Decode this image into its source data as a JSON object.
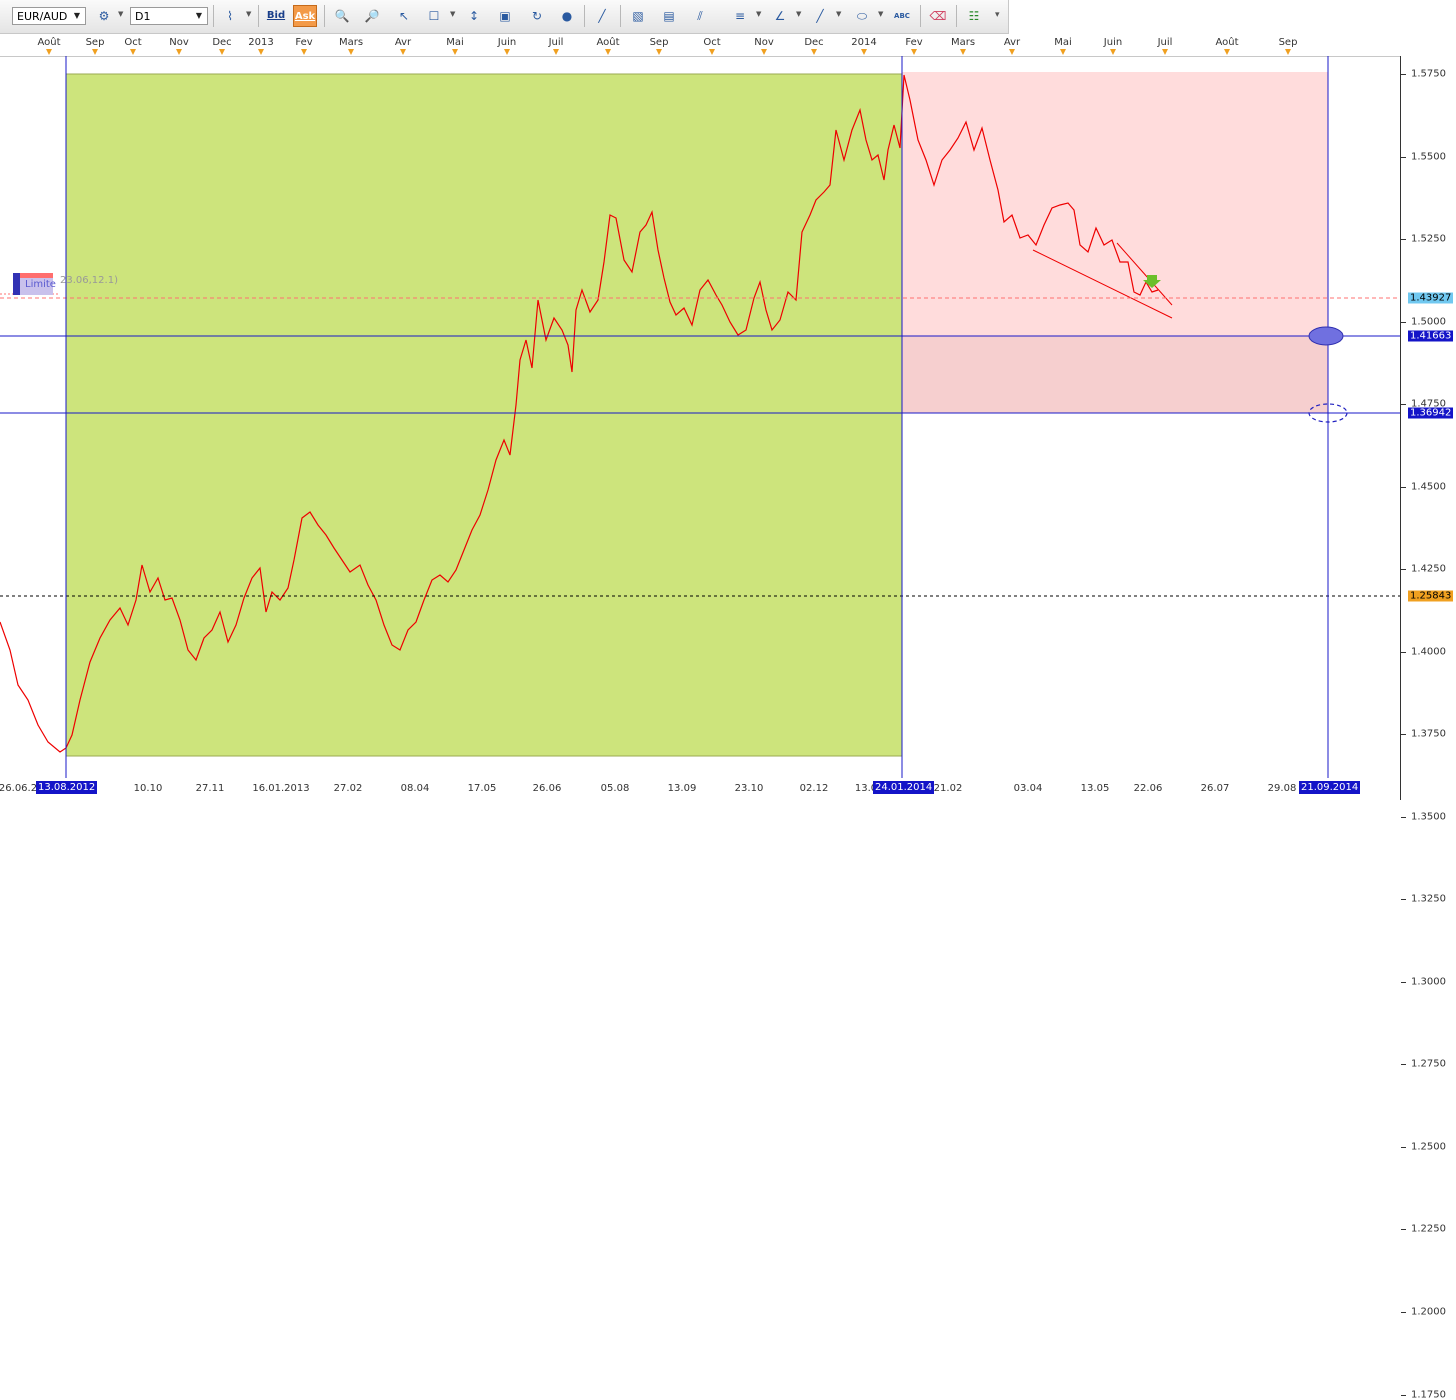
{
  "toolbar": {
    "symbol": "EUR/AUD",
    "timeframe": "D1",
    "bid_label": "Bid",
    "ask_label": "Ask",
    "abc_label": "ABC"
  },
  "top_axis_months": [
    "Août",
    "Sep",
    "Oct",
    "Nov",
    "Dec",
    "2013",
    "Fev",
    "Mars",
    "Avr",
    "Mai",
    "Juin",
    "Juil",
    "Août",
    "Sep",
    "Oct",
    "Nov",
    "Dec",
    "2014",
    "Fev",
    "Mars",
    "Avr",
    "Mai",
    "Juin",
    "Juil",
    "Août",
    "Sep"
  ],
  "bottom_axis_dates": [
    "26.06.2",
    "10.10",
    "27.11",
    "16.01.2013",
    "27.02",
    "08.04",
    "17.05",
    "26.06",
    "05.08",
    "13.09",
    "23.10",
    "02.12",
    "13.0",
    "21.02",
    "03.04",
    "13.05",
    "22.06",
    "26.07",
    "29.08"
  ],
  "bottom_axis_selected": {
    "start": "13.08.2012",
    "end_green": "24.01.2014",
    "end_projection": "21.09.2014"
  },
  "price_ticks": [
    "1.5750",
    "1.5500",
    "1.5250",
    "1.5000",
    "1.4750",
    "1.4500",
    "1.4250",
    "1.4000",
    "1.3750",
    "1.3500",
    "1.3250",
    "1.3000",
    "1.2750",
    "1.2500",
    "1.2250",
    "1.2000",
    "1.1750"
  ],
  "price_labels": {
    "current": "1.43927",
    "line_upper": "1.41663",
    "line_lower": "1.36942",
    "dotted": "1.25843"
  },
  "colors": {
    "up_zone": "#cde47c",
    "down_zone": "#ffdcdc",
    "down_zone_deep": "#f6cfcf",
    "price_line": "#ee0000",
    "level_line": "#1818c8",
    "current_label": "#70c8f0",
    "line_label": "#1414c8",
    "dotted_label": "#f0a020"
  },
  "limit_label": {
    "text": "Limite",
    "coords": "23.06,12.1)"
  }
}
